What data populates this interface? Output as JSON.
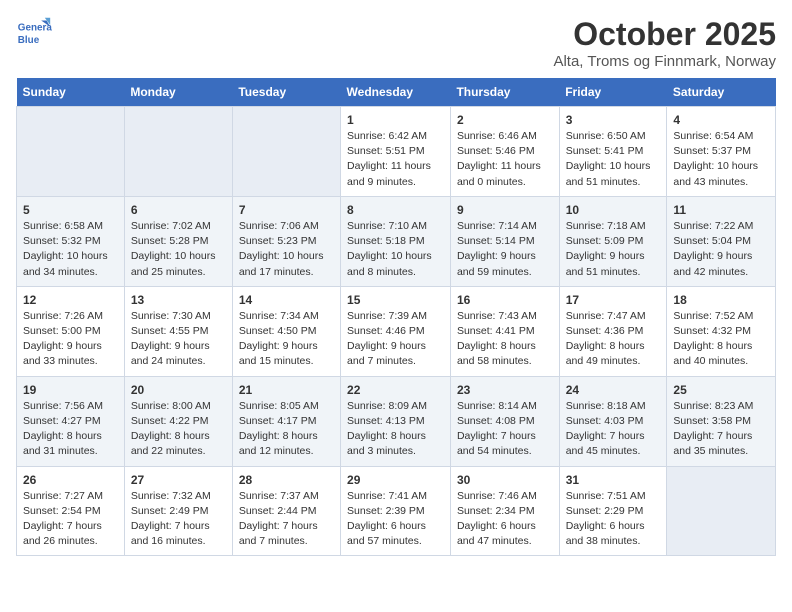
{
  "header": {
    "logo_line1": "General",
    "logo_line2": "Blue",
    "title": "October 2025",
    "subtitle": "Alta, Troms og Finnmark, Norway"
  },
  "days_of_week": [
    "Sunday",
    "Monday",
    "Tuesday",
    "Wednesday",
    "Thursday",
    "Friday",
    "Saturday"
  ],
  "weeks": [
    {
      "days": [
        {
          "num": "",
          "info": "",
          "empty": true
        },
        {
          "num": "",
          "info": "",
          "empty": true
        },
        {
          "num": "",
          "info": "",
          "empty": true
        },
        {
          "num": "1",
          "info": "Sunrise: 6:42 AM\nSunset: 5:51 PM\nDaylight: 11 hours and 9 minutes.",
          "empty": false
        },
        {
          "num": "2",
          "info": "Sunrise: 6:46 AM\nSunset: 5:46 PM\nDaylight: 11 hours and 0 minutes.",
          "empty": false
        },
        {
          "num": "3",
          "info": "Sunrise: 6:50 AM\nSunset: 5:41 PM\nDaylight: 10 hours and 51 minutes.",
          "empty": false
        },
        {
          "num": "4",
          "info": "Sunrise: 6:54 AM\nSunset: 5:37 PM\nDaylight: 10 hours and 43 minutes.",
          "empty": false
        }
      ]
    },
    {
      "days": [
        {
          "num": "5",
          "info": "Sunrise: 6:58 AM\nSunset: 5:32 PM\nDaylight: 10 hours and 34 minutes.",
          "empty": false
        },
        {
          "num": "6",
          "info": "Sunrise: 7:02 AM\nSunset: 5:28 PM\nDaylight: 10 hours and 25 minutes.",
          "empty": false
        },
        {
          "num": "7",
          "info": "Sunrise: 7:06 AM\nSunset: 5:23 PM\nDaylight: 10 hours and 17 minutes.",
          "empty": false
        },
        {
          "num": "8",
          "info": "Sunrise: 7:10 AM\nSunset: 5:18 PM\nDaylight: 10 hours and 8 minutes.",
          "empty": false
        },
        {
          "num": "9",
          "info": "Sunrise: 7:14 AM\nSunset: 5:14 PM\nDaylight: 9 hours and 59 minutes.",
          "empty": false
        },
        {
          "num": "10",
          "info": "Sunrise: 7:18 AM\nSunset: 5:09 PM\nDaylight: 9 hours and 51 minutes.",
          "empty": false
        },
        {
          "num": "11",
          "info": "Sunrise: 7:22 AM\nSunset: 5:04 PM\nDaylight: 9 hours and 42 minutes.",
          "empty": false
        }
      ]
    },
    {
      "days": [
        {
          "num": "12",
          "info": "Sunrise: 7:26 AM\nSunset: 5:00 PM\nDaylight: 9 hours and 33 minutes.",
          "empty": false
        },
        {
          "num": "13",
          "info": "Sunrise: 7:30 AM\nSunset: 4:55 PM\nDaylight: 9 hours and 24 minutes.",
          "empty": false
        },
        {
          "num": "14",
          "info": "Sunrise: 7:34 AM\nSunset: 4:50 PM\nDaylight: 9 hours and 15 minutes.",
          "empty": false
        },
        {
          "num": "15",
          "info": "Sunrise: 7:39 AM\nSunset: 4:46 PM\nDaylight: 9 hours and 7 minutes.",
          "empty": false
        },
        {
          "num": "16",
          "info": "Sunrise: 7:43 AM\nSunset: 4:41 PM\nDaylight: 8 hours and 58 minutes.",
          "empty": false
        },
        {
          "num": "17",
          "info": "Sunrise: 7:47 AM\nSunset: 4:36 PM\nDaylight: 8 hours and 49 minutes.",
          "empty": false
        },
        {
          "num": "18",
          "info": "Sunrise: 7:52 AM\nSunset: 4:32 PM\nDaylight: 8 hours and 40 minutes.",
          "empty": false
        }
      ]
    },
    {
      "days": [
        {
          "num": "19",
          "info": "Sunrise: 7:56 AM\nSunset: 4:27 PM\nDaylight: 8 hours and 31 minutes.",
          "empty": false
        },
        {
          "num": "20",
          "info": "Sunrise: 8:00 AM\nSunset: 4:22 PM\nDaylight: 8 hours and 22 minutes.",
          "empty": false
        },
        {
          "num": "21",
          "info": "Sunrise: 8:05 AM\nSunset: 4:17 PM\nDaylight: 8 hours and 12 minutes.",
          "empty": false
        },
        {
          "num": "22",
          "info": "Sunrise: 8:09 AM\nSunset: 4:13 PM\nDaylight: 8 hours and 3 minutes.",
          "empty": false
        },
        {
          "num": "23",
          "info": "Sunrise: 8:14 AM\nSunset: 4:08 PM\nDaylight: 7 hours and 54 minutes.",
          "empty": false
        },
        {
          "num": "24",
          "info": "Sunrise: 8:18 AM\nSunset: 4:03 PM\nDaylight: 7 hours and 45 minutes.",
          "empty": false
        },
        {
          "num": "25",
          "info": "Sunrise: 8:23 AM\nSunset: 3:58 PM\nDaylight: 7 hours and 35 minutes.",
          "empty": false
        }
      ]
    },
    {
      "days": [
        {
          "num": "26",
          "info": "Sunrise: 7:27 AM\nSunset: 2:54 PM\nDaylight: 7 hours and 26 minutes.",
          "empty": false
        },
        {
          "num": "27",
          "info": "Sunrise: 7:32 AM\nSunset: 2:49 PM\nDaylight: 7 hours and 16 minutes.",
          "empty": false
        },
        {
          "num": "28",
          "info": "Sunrise: 7:37 AM\nSunset: 2:44 PM\nDaylight: 7 hours and 7 minutes.",
          "empty": false
        },
        {
          "num": "29",
          "info": "Sunrise: 7:41 AM\nSunset: 2:39 PM\nDaylight: 6 hours and 57 minutes.",
          "empty": false
        },
        {
          "num": "30",
          "info": "Sunrise: 7:46 AM\nSunset: 2:34 PM\nDaylight: 6 hours and 47 minutes.",
          "empty": false
        },
        {
          "num": "31",
          "info": "Sunrise: 7:51 AM\nSunset: 2:29 PM\nDaylight: 6 hours and 38 minutes.",
          "empty": false
        },
        {
          "num": "",
          "info": "",
          "empty": true
        }
      ]
    }
  ]
}
